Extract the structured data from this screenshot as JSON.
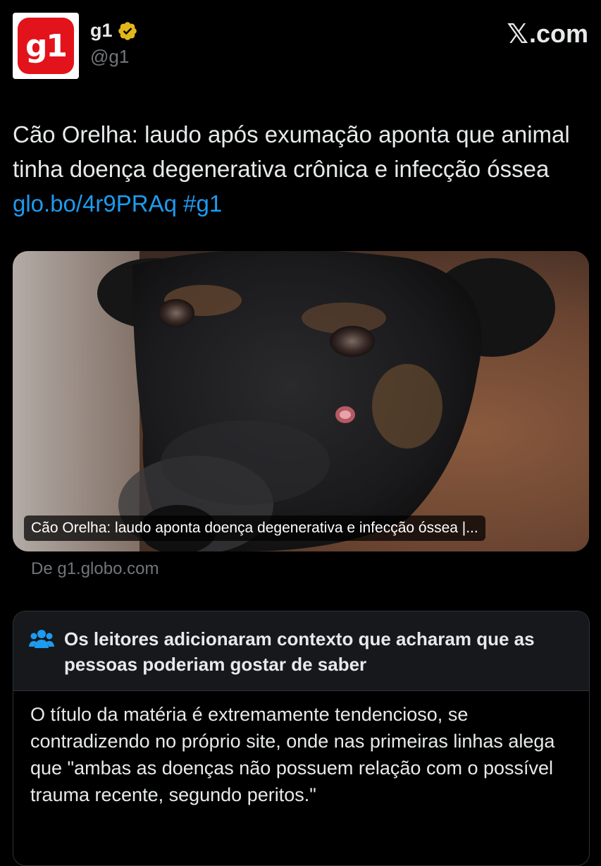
{
  "account": {
    "avatar_text": "g1",
    "display_name": "g1",
    "handle": "@g1",
    "verified": true,
    "verified_icon": "verified-badge-icon",
    "brand_colors": {
      "avatar_red": "#e3131b",
      "verified_gold": "#e2b719"
    }
  },
  "brand": {
    "x_glyph": "𝕏",
    "label": ".com"
  },
  "tweet": {
    "text_main": "Cão Orelha: laudo após exumação aponta que animal tinha doença degenerativa crônica e infecção óssea ",
    "link": "glo.bo/4r9PRAq",
    "hashtag": "#g1",
    "link_color": "#1d9bf0"
  },
  "card": {
    "image_subject": "dog-photo",
    "caption": "Cão Orelha: laudo aponta doença degenerativa e infecção óssea |...",
    "source": "De g1.globo.com"
  },
  "community_note": {
    "icon": "people-icon",
    "title": "Os leitores adicionaram contexto que acharam que as pessoas poderiam gostar de saber",
    "body": "O título da matéria é extremamente tendencioso, se contradizendo no próprio site, onde nas primeiras linhas alega que \"ambas as doenças não possuem relação com o possível trauma recente, segundo peritos.\""
  }
}
